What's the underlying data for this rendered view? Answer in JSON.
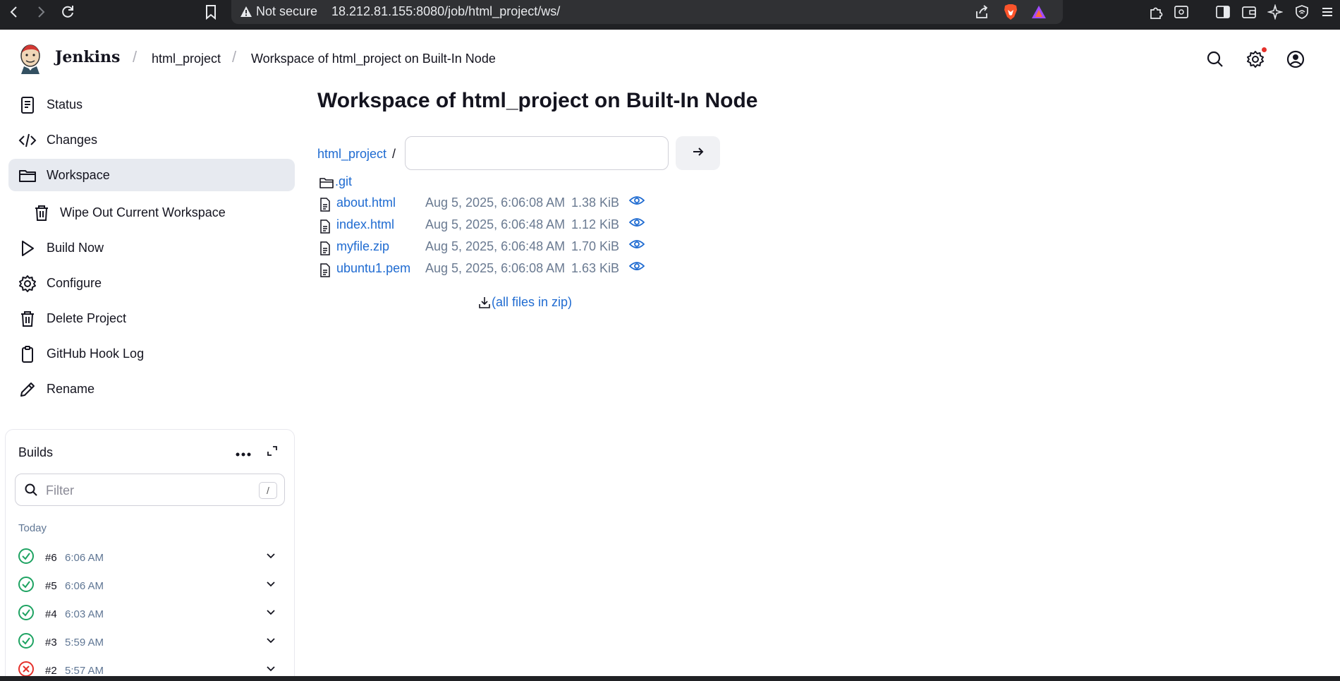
{
  "browser": {
    "security_label": "Not secure",
    "url": "18.212.81.155:8080/job/html_project/ws/"
  },
  "header": {
    "brand": "Jenkins",
    "breadcrumbs": [
      "html_project",
      "Workspace of html_project on Built-In Node"
    ]
  },
  "sidebar": {
    "items": [
      {
        "label": "Status",
        "icon": "document-icon"
      },
      {
        "label": "Changes",
        "icon": "code-icon"
      },
      {
        "label": "Workspace",
        "icon": "folder-icon",
        "active": true
      },
      {
        "label": "Wipe Out Current Workspace",
        "icon": "trash-icon",
        "sub": true
      },
      {
        "label": "Build Now",
        "icon": "play-icon"
      },
      {
        "label": "Configure",
        "icon": "gear-icon"
      },
      {
        "label": "Delete Project",
        "icon": "trash-icon"
      },
      {
        "label": "GitHub Hook Log",
        "icon": "clipboard-icon"
      },
      {
        "label": "Rename",
        "icon": "pencil-icon"
      }
    ]
  },
  "builds": {
    "title": "Builds",
    "filter_placeholder": "Filter",
    "filter_shortcut": "/",
    "group_label": "Today",
    "rows": [
      {
        "number": "#6",
        "time": "6:06 AM",
        "status": "success"
      },
      {
        "number": "#5",
        "time": "6:06 AM",
        "status": "success"
      },
      {
        "number": "#4",
        "time": "6:03 AM",
        "status": "success"
      },
      {
        "number": "#3",
        "time": "5:59 AM",
        "status": "success"
      },
      {
        "number": "#2",
        "time": "5:57 AM",
        "status": "failed"
      }
    ]
  },
  "main": {
    "title": "Workspace of html_project on Built-In Node",
    "path_root": "html_project",
    "path_separator": "/",
    "path_input_value": "",
    "folder": {
      "name": ".git"
    },
    "files": [
      {
        "name": "about.html",
        "date": "Aug 5, 2025, 6:06:08 AM",
        "size": "1.38 KiB"
      },
      {
        "name": "index.html",
        "date": "Aug 5, 2025, 6:06:48 AM",
        "size": "1.12 KiB"
      },
      {
        "name": "myfile.zip",
        "date": "Aug 5, 2025, 6:06:48 AM",
        "size": "1.70 KiB"
      },
      {
        "name": "ubuntu1.pem",
        "date": "Aug 5, 2025, 6:06:08 AM",
        "size": "1.63 KiB"
      }
    ],
    "zip_link": "(all files in zip)"
  },
  "colors": {
    "link": "#1f6bd1",
    "success": "#1ea362",
    "failed": "#e5312b",
    "active_bg": "#e7eaf0"
  }
}
